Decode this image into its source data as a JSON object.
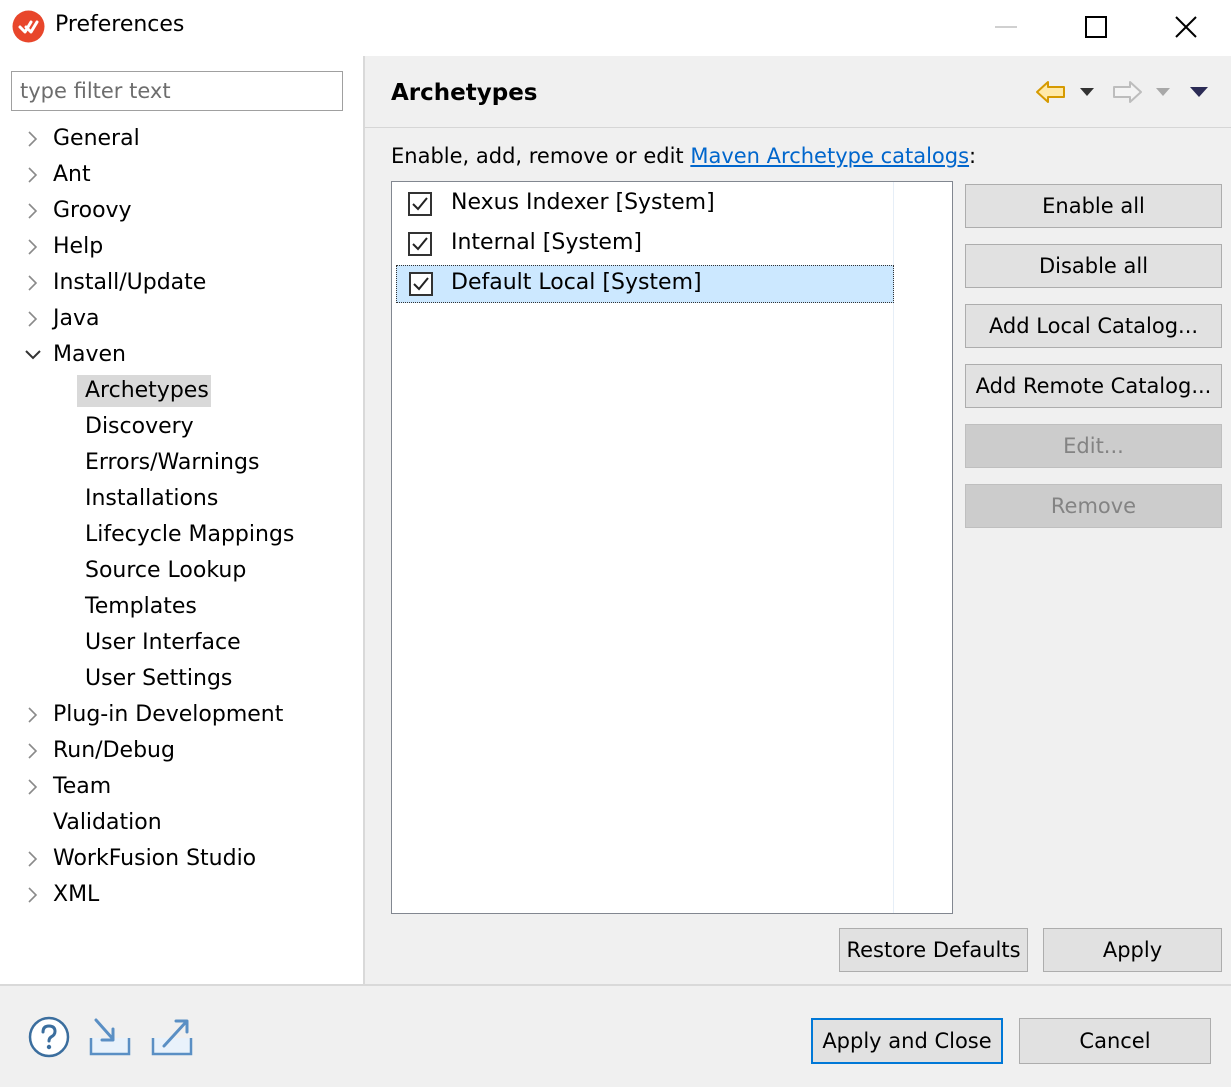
{
  "window": {
    "title": "Preferences",
    "logo_icon": "eclipse-logo-icon",
    "accent": "#e8462b"
  },
  "sidebar": {
    "filter_placeholder": "type filter text",
    "filter_value": "",
    "items": [
      {
        "label": "General",
        "expandable": true,
        "expanded": false
      },
      {
        "label": "Ant",
        "expandable": true,
        "expanded": false
      },
      {
        "label": "Groovy",
        "expandable": true,
        "expanded": false
      },
      {
        "label": "Help",
        "expandable": true,
        "expanded": false
      },
      {
        "label": "Install/Update",
        "expandable": true,
        "expanded": false
      },
      {
        "label": "Java",
        "expandable": true,
        "expanded": false
      },
      {
        "label": "Maven",
        "expandable": true,
        "expanded": true
      },
      {
        "label": "Archetypes",
        "child": true,
        "selected": true
      },
      {
        "label": "Discovery",
        "child": true
      },
      {
        "label": "Errors/Warnings",
        "child": true
      },
      {
        "label": "Installations",
        "child": true
      },
      {
        "label": "Lifecycle Mappings",
        "child": true
      },
      {
        "label": "Source Lookup",
        "child": true
      },
      {
        "label": "Templates",
        "child": true
      },
      {
        "label": "User Interface",
        "child": true
      },
      {
        "label": "User Settings",
        "child": true
      },
      {
        "label": "Plug-in Development",
        "expandable": true,
        "expanded": false
      },
      {
        "label": "Run/Debug",
        "expandable": true,
        "expanded": false
      },
      {
        "label": "Team",
        "expandable": true,
        "expanded": false
      },
      {
        "label": "Validation",
        "expandable": false
      },
      {
        "label": "WorkFusion Studio",
        "expandable": true,
        "expanded": false
      },
      {
        "label": "XML",
        "expandable": true,
        "expanded": false
      }
    ]
  },
  "page": {
    "title": "Archetypes",
    "nav_icons": [
      "back-arrow-icon",
      "back-menu-icon",
      "forward-arrow-icon",
      "forward-menu-icon",
      "view-menu-icon"
    ],
    "description_prefix": "Enable, add, remove or edit ",
    "description_link": "Maven Archetype catalogs",
    "description_suffix": ":",
    "catalogs": [
      {
        "label": "Nexus Indexer [System]",
        "checked": true,
        "selected": false
      },
      {
        "label": "Internal [System]",
        "checked": true,
        "selected": false
      },
      {
        "label": "Default Local [System]",
        "checked": true,
        "selected": true
      }
    ],
    "buttons": {
      "enable_all": "Enable all",
      "disable_all": "Disable all",
      "add_local": "Add Local Catalog...",
      "add_remote": "Add Remote Catalog...",
      "edit": "Edit...",
      "remove": "Remove"
    },
    "restore_defaults": "Restore Defaults",
    "apply": "Apply"
  },
  "footer": {
    "icons": [
      "help-icon",
      "import-icon",
      "export-icon"
    ],
    "apply_and_close": "Apply and Close",
    "cancel": "Cancel"
  }
}
